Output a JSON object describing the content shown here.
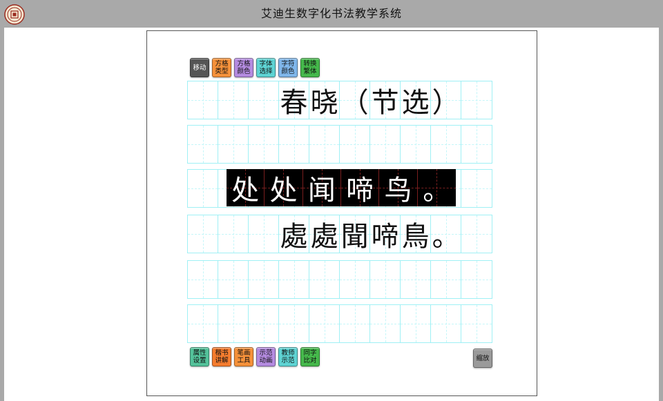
{
  "app": {
    "title": "艾迪生数字化书法教学系统"
  },
  "top_toolbar": [
    {
      "label": "移动",
      "color": "#555555",
      "text_color": "#ffffff"
    },
    {
      "label": "方格类型",
      "color": "#f5913a",
      "text_color": "#111111"
    },
    {
      "label": "方格颜色",
      "color": "#b48be0",
      "text_color": "#111111"
    },
    {
      "label": "字体选择",
      "color": "#5ed3d3",
      "text_color": "#111111"
    },
    {
      "label": "字符颜色",
      "color": "#7fb6ea",
      "text_color": "#111111"
    },
    {
      "label": "转换繁体",
      "color": "#45b84b",
      "text_color": "#111111"
    }
  ],
  "bottom_toolbar": [
    {
      "label": "属性设置",
      "color": "#53c29a",
      "text_color": "#111111"
    },
    {
      "label": "楷书讲解",
      "color": "#f57c2e",
      "text_color": "#111111"
    },
    {
      "label": "笔画工具",
      "color": "#f5913a",
      "text_color": "#111111"
    },
    {
      "label": "示范动画",
      "color": "#b48be0",
      "text_color": "#111111"
    },
    {
      "label": "教师示范",
      "color": "#5ed3d3",
      "text_color": "#111111"
    },
    {
      "label": "同字比对",
      "color": "#45b84b",
      "text_color": "#111111"
    }
  ],
  "zoom_button": {
    "label": "缩放",
    "color": "#9a9a9a",
    "text_color": "#111111"
  },
  "grid": {
    "line_color": "#9ff0f5",
    "rows": [
      [
        "",
        "",
        "",
        "春",
        "晓",
        "（",
        "节",
        "选",
        "）",
        ""
      ],
      [
        "",
        "",
        "",
        "",
        "",
        "",
        "",
        "",
        "",
        ""
      ],
      [
        "",
        "",
        "",
        "",
        "",
        "",
        "",
        "",
        "",
        ""
      ],
      [
        "",
        "",
        "",
        "處",
        "處",
        "聞",
        "啼",
        "鳥",
        "。",
        ""
      ],
      [
        "",
        "",
        "",
        "",
        "",
        "",
        "",
        "",
        "",
        ""
      ],
      [
        "",
        "",
        "",
        "",
        "",
        "",
        "",
        "",
        "",
        ""
      ]
    ]
  },
  "highlight_row": {
    "background": "#000000",
    "text_color": "#ffffff",
    "chars": [
      "处",
      "处",
      "闻",
      "啼",
      "鸟",
      "。"
    ]
  }
}
